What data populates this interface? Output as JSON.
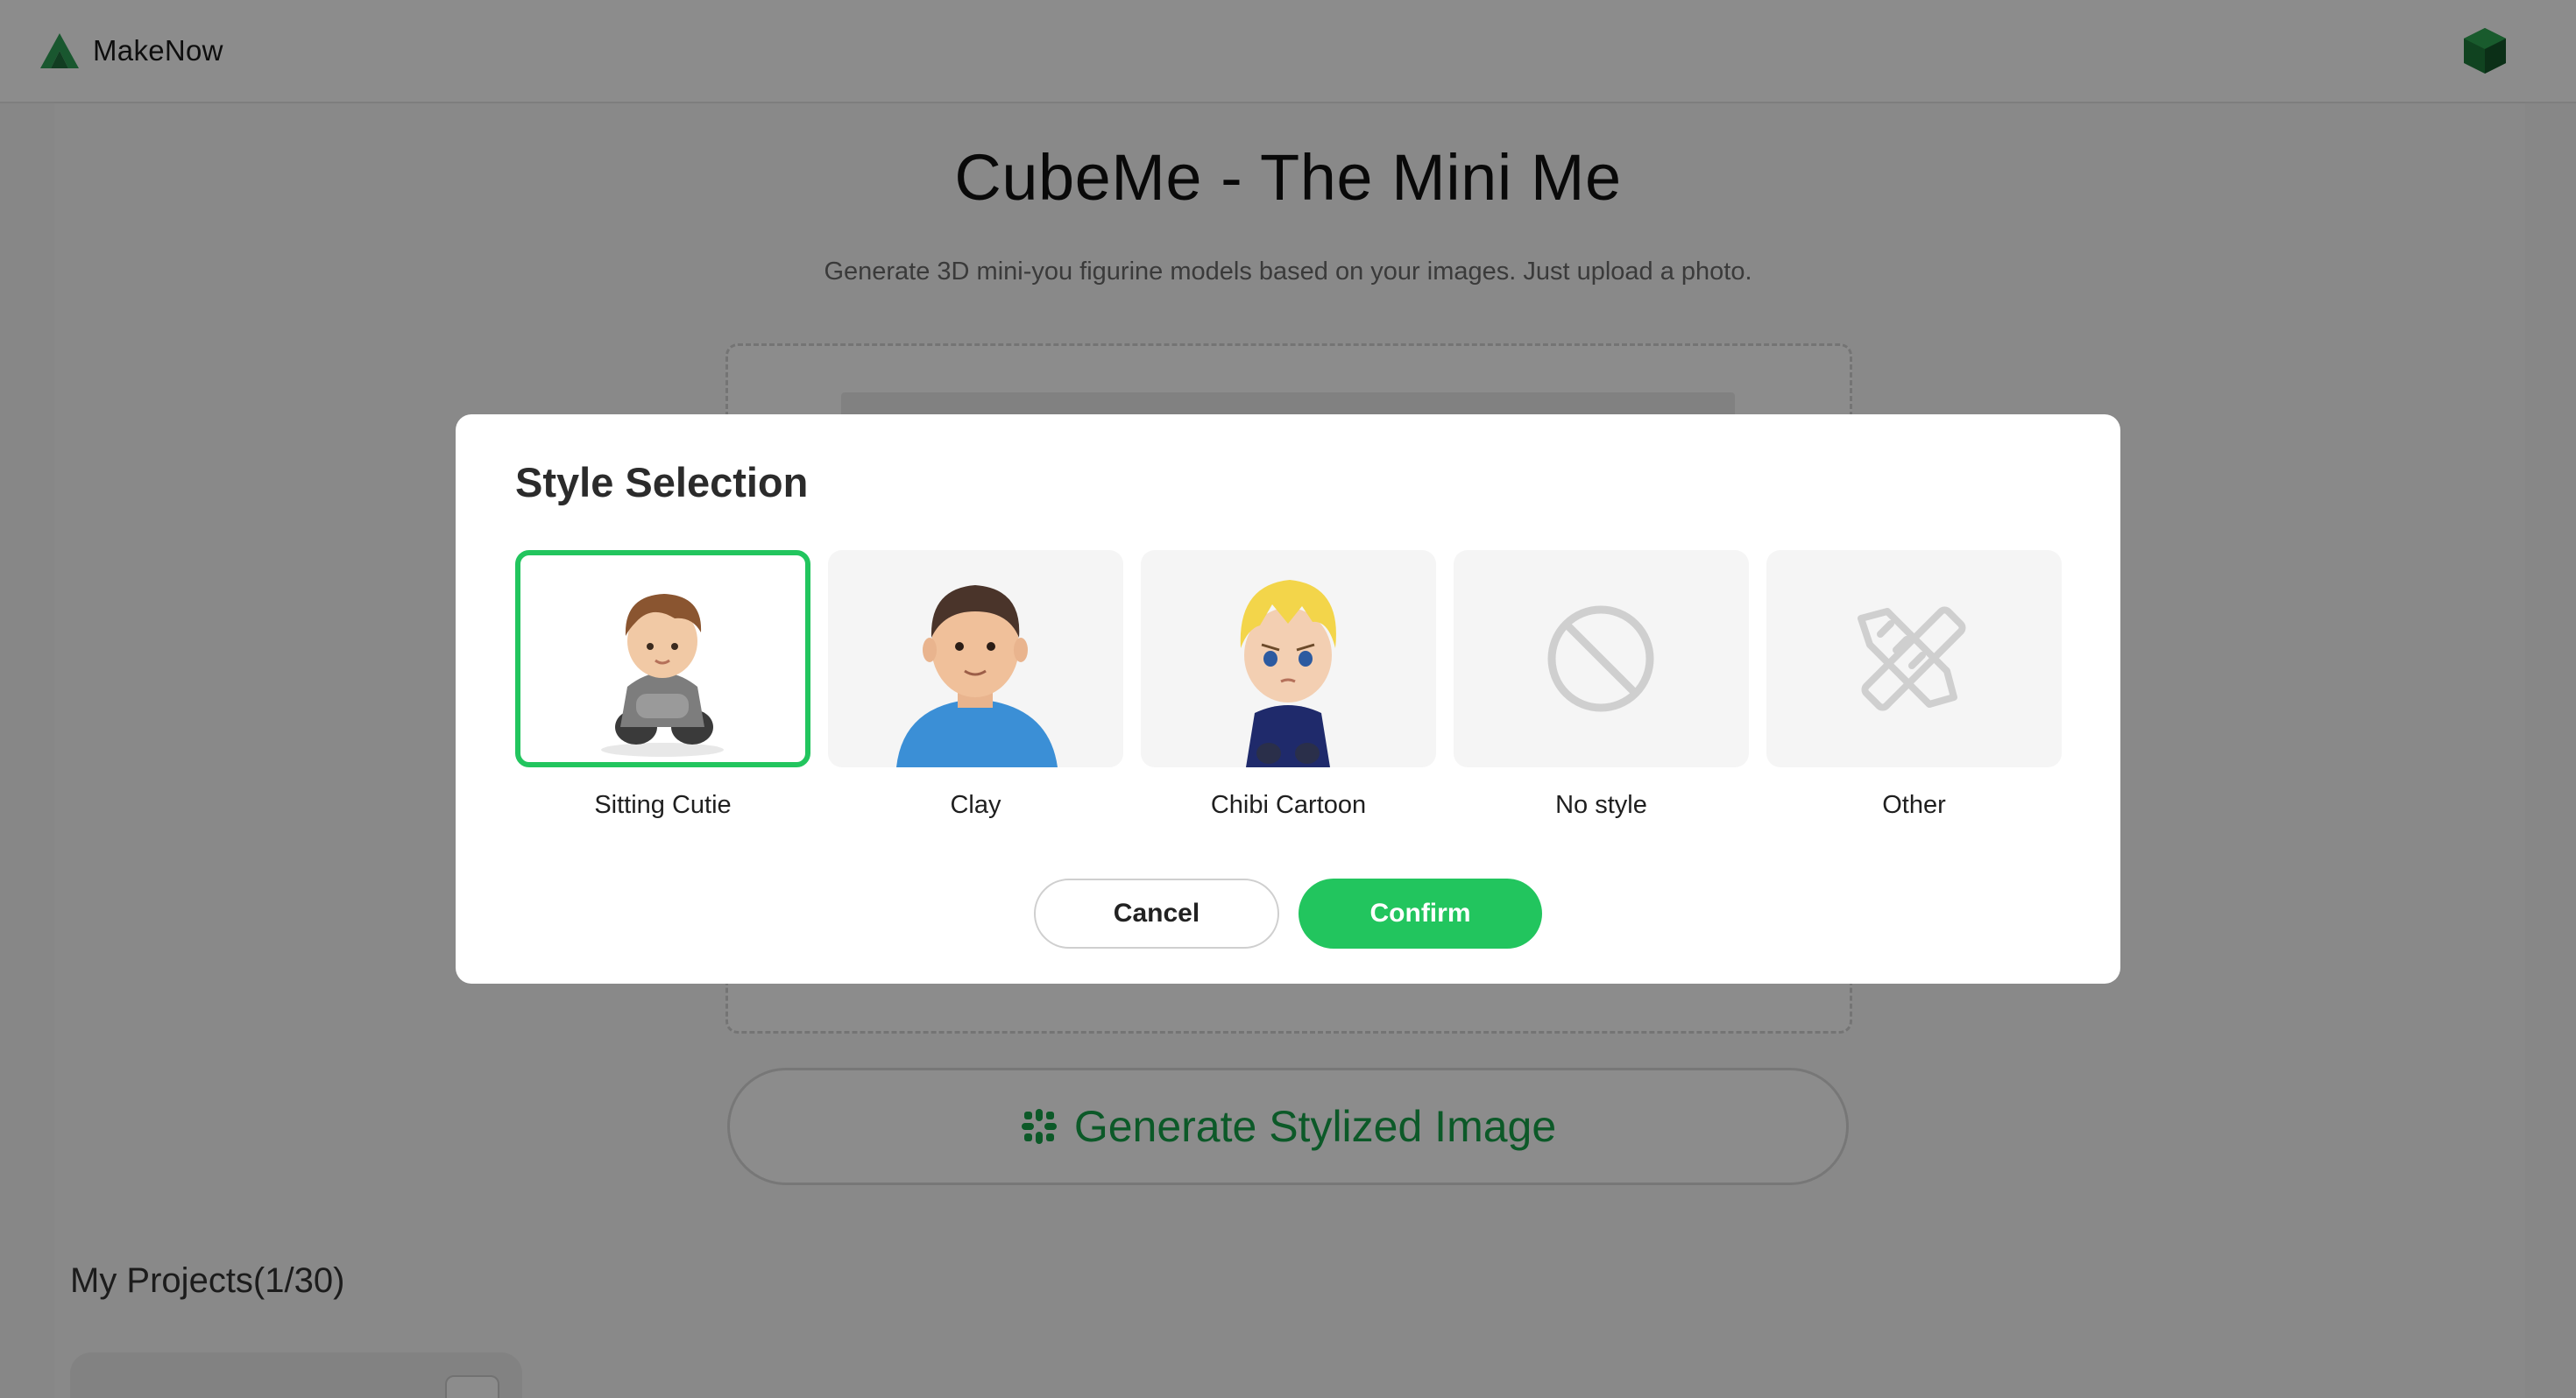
{
  "app": {
    "name": "MakeNow"
  },
  "hero": {
    "title": "CubeMe - The Mini Me",
    "subtitle": "Generate 3D mini-you figurine models based on your images. Just upload a photo."
  },
  "generate_button": {
    "label": "Generate Stylized Image",
    "icon": "sparkle-grid-icon"
  },
  "projects": {
    "title": "My Projects(1/30)"
  },
  "modal": {
    "title": "Style Selection",
    "styles": [
      {
        "label": "Sitting Cutie",
        "selected": true,
        "thumbnail": "sitting-boy-figurine"
      },
      {
        "label": "Clay",
        "selected": false,
        "thumbnail": "clay-man-figurine"
      },
      {
        "label": "Chibi Cartoon",
        "selected": false,
        "thumbnail": "chibi-blonde-figurine"
      },
      {
        "label": "No style",
        "selected": false,
        "thumbnail": "prohibited-icon"
      },
      {
        "label": "Other",
        "selected": false,
        "thumbnail": "pencil-ruler-icon"
      }
    ],
    "cancel_label": "Cancel",
    "confirm_label": "Confirm"
  },
  "colors": {
    "accent": "#22c55e",
    "accent_text": "#16a34a",
    "overlay": "rgba(0,0,0,0.45)"
  }
}
